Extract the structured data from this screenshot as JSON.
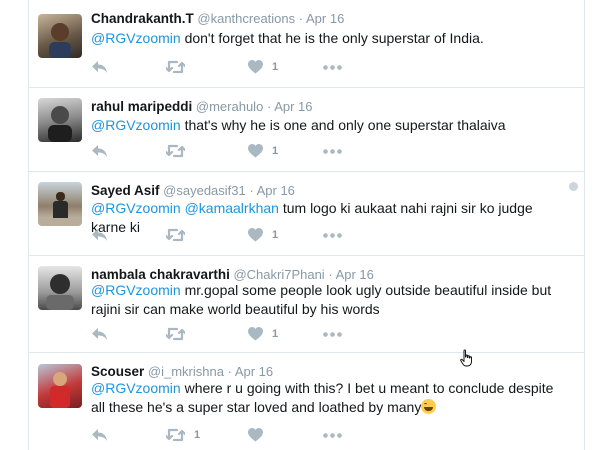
{
  "tweets": [
    {
      "name": "Chandrakanth.T",
      "handle": "@kanthcreations",
      "separator": "·",
      "time": "Apr 16",
      "mention": "@RGVzoomin",
      "text": " don't forget that he is the only superstar of India.",
      "retweets": "",
      "likes": "1"
    },
    {
      "name": "rahul maripeddi",
      "handle": "@merahulo",
      "separator": "·",
      "time": "Apr 16",
      "mention": "@RGVzoomin",
      "text": " that's why he is one and only one superstar thalaiva",
      "retweets": "",
      "likes": "1"
    },
    {
      "name": "Sayed Asif",
      "handle": "@sayedasif31",
      "separator": "·",
      "time": "Apr 16",
      "mention": "@RGVzoomin",
      "mention2": "@kamaalrkhan",
      "text": " tum logo ki aukaat nahi rajni sir ko judge karne ki",
      "retweets": "",
      "likes": "1"
    },
    {
      "name": "nambala chakravarthi",
      "handle": "@Chakri7Phani",
      "separator": "·",
      "time": "Apr 16",
      "mention": "@RGVzoomin",
      "text": " mr.gopal some people look ugly outside beautiful inside but rajini sir can make world beautiful  by his words",
      "retweets": "",
      "likes": "1"
    },
    {
      "name": "Scouser",
      "handle": "@i_mkrishna",
      "separator": "·",
      "time": "Apr 16",
      "mention": "@RGVzoomin",
      "text": " where r u going with this? I bet u meant to conclude despite all these he's a super star loved and loathed by many",
      "retweets": "1",
      "likes": ""
    }
  ],
  "icons": {
    "reply": "reply-icon",
    "retweet": "retweet-icon",
    "like": "heart-icon",
    "more": "more-dots-icon",
    "emoji": "grinning-face-emoji"
  },
  "colors": {
    "mention": "#1b95e0",
    "meta": "#8899a6",
    "action": "#aab8c2",
    "border": "#e1e8ed"
  }
}
